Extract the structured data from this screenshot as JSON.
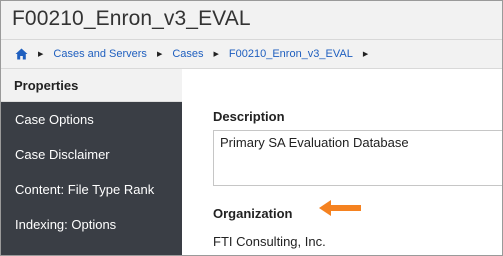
{
  "window": {
    "title": "F00210_Enron_v3_EVAL"
  },
  "breadcrumb": {
    "items": [
      {
        "label": "Cases and Servers"
      },
      {
        "label": "Cases"
      },
      {
        "label": "F00210_Enron_v3_EVAL"
      }
    ]
  },
  "panel": {
    "heading": "Properties"
  },
  "sidebar": {
    "items": [
      {
        "label": "Case Options"
      },
      {
        "label": "Case Disclaimer"
      },
      {
        "label": "Content: File Type Rank"
      },
      {
        "label": "Indexing: Options"
      }
    ]
  },
  "main": {
    "description": {
      "label": "Description",
      "value": "Primary SA Evaluation Database"
    },
    "organization": {
      "label": "Organization",
      "value": "FTI Consulting, Inc."
    }
  },
  "colors": {
    "link": "#1f5fbf",
    "sidebar_bg": "#3a3e45",
    "header_bg": "#f2f2f2",
    "arrow": "#f58220"
  },
  "icons": {
    "home": "home-icon",
    "separator": "triangle-right-icon",
    "annotation": "arrow-left-icon"
  }
}
